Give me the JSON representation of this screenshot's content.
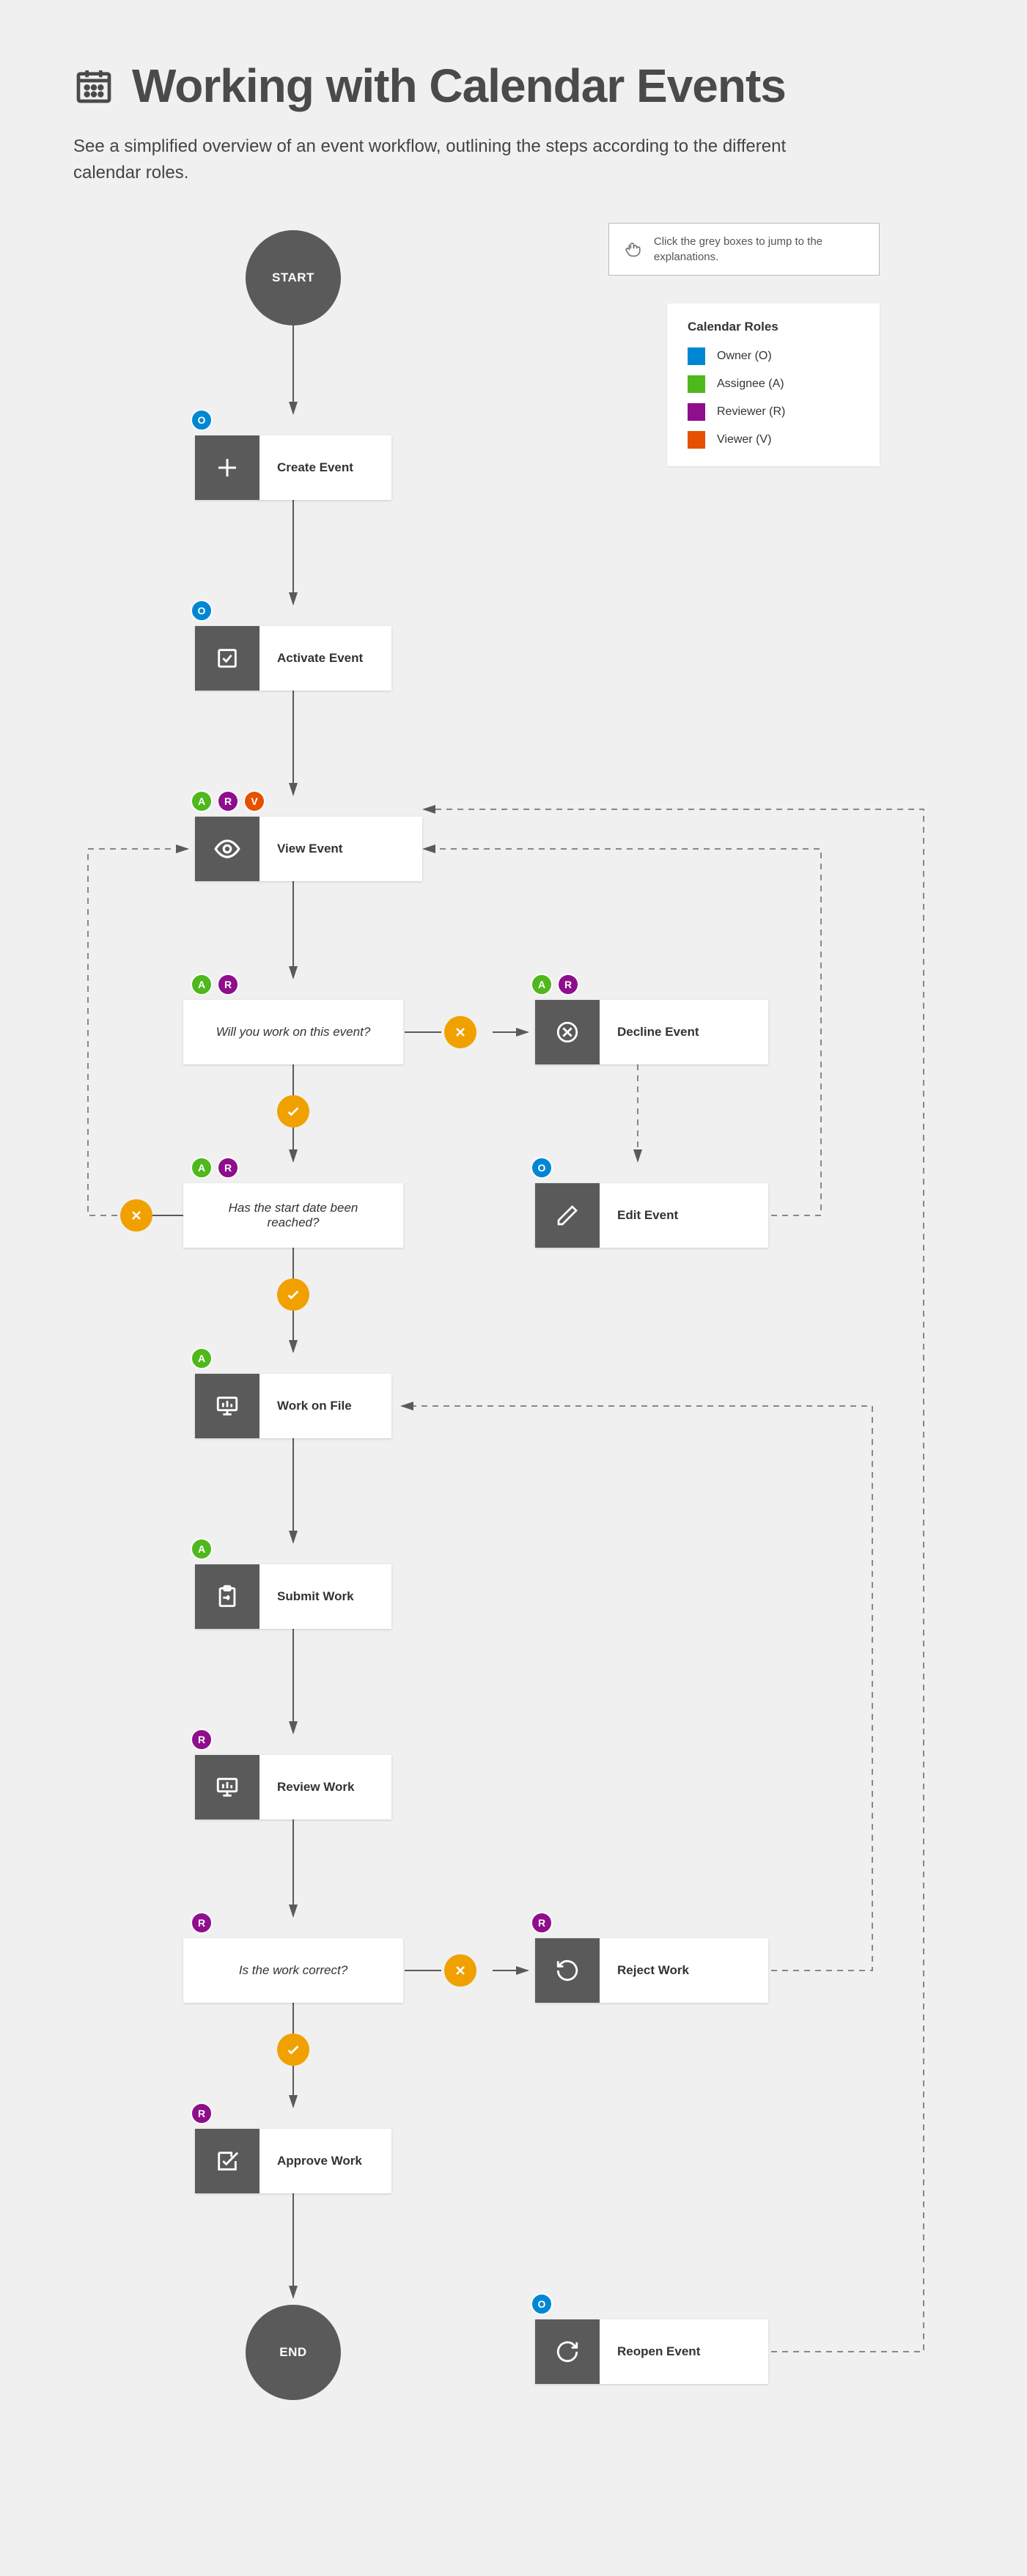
{
  "title": "Working with Calendar Events",
  "subtitle": "See a simplified overview of an event workflow, outlining the steps according to the different calendar roles.",
  "info_text": "Click the grey boxes to jump to the explanations.",
  "legend": {
    "title": "Calendar Roles",
    "items": [
      {
        "label": "Owner (O)",
        "color": "#0087d4"
      },
      {
        "label": "Assignee (A)",
        "color": "#4fb81c"
      },
      {
        "label": "Reviewer (R)",
        "color": "#8e0e8c"
      },
      {
        "label": "Viewer (V)",
        "color": "#e55100"
      }
    ]
  },
  "start": "START",
  "end": "END",
  "steps": {
    "create": "Create Event",
    "activate": "Activate Event",
    "view": "View Event",
    "decline": "Decline Event",
    "edit": "Edit Event",
    "work": "Work on File",
    "submit": "Submit Work",
    "review": "Review Work",
    "reject": "Reject Work",
    "approve": "Approve Work",
    "reopen": "Reopen Event"
  },
  "decisions": {
    "work_on": "Will you work on this event?",
    "date_reached": "Has the start date been reached?",
    "correct": "Is the work correct?"
  },
  "roles": {
    "create": [
      "O"
    ],
    "activate": [
      "O"
    ],
    "view": [
      "A",
      "R",
      "V"
    ],
    "work_on": [
      "A",
      "R"
    ],
    "decline": [
      "A",
      "R"
    ],
    "date_reached": [
      "A",
      "R"
    ],
    "edit": [
      "O"
    ],
    "work": [
      "A"
    ],
    "submit": [
      "A"
    ],
    "review": [
      "R"
    ],
    "correct": [
      "R"
    ],
    "reject": [
      "R"
    ],
    "approve": [
      "R"
    ],
    "reopen": [
      "O"
    ]
  },
  "chart_data": {
    "type": "flowchart",
    "nodes": [
      {
        "id": "start",
        "type": "terminal",
        "label": "START"
      },
      {
        "id": "create",
        "type": "process",
        "label": "Create Event",
        "roles": [
          "O"
        ]
      },
      {
        "id": "activate",
        "type": "process",
        "label": "Activate Event",
        "roles": [
          "O"
        ]
      },
      {
        "id": "view",
        "type": "process",
        "label": "View Event",
        "roles": [
          "A",
          "R",
          "V"
        ]
      },
      {
        "id": "work_on",
        "type": "decision",
        "label": "Will you work on this event?",
        "roles": [
          "A",
          "R"
        ]
      },
      {
        "id": "decline",
        "type": "process",
        "label": "Decline Event",
        "roles": [
          "A",
          "R"
        ]
      },
      {
        "id": "edit",
        "type": "process",
        "label": "Edit Event",
        "roles": [
          "O"
        ]
      },
      {
        "id": "date_reached",
        "type": "decision",
        "label": "Has the start date been reached?",
        "roles": [
          "A",
          "R"
        ]
      },
      {
        "id": "work",
        "type": "process",
        "label": "Work on File",
        "roles": [
          "A"
        ]
      },
      {
        "id": "submit",
        "type": "process",
        "label": "Submit Work",
        "roles": [
          "A"
        ]
      },
      {
        "id": "review",
        "type": "process",
        "label": "Review Work",
        "roles": [
          "R"
        ]
      },
      {
        "id": "correct",
        "type": "decision",
        "label": "Is the work correct?",
        "roles": [
          "R"
        ]
      },
      {
        "id": "reject",
        "type": "process",
        "label": "Reject Work",
        "roles": [
          "R"
        ]
      },
      {
        "id": "approve",
        "type": "process",
        "label": "Approve Work",
        "roles": [
          "R"
        ]
      },
      {
        "id": "end",
        "type": "terminal",
        "label": "END"
      },
      {
        "id": "reopen",
        "type": "process",
        "label": "Reopen Event",
        "roles": [
          "O"
        ]
      }
    ],
    "edges": [
      {
        "from": "start",
        "to": "create"
      },
      {
        "from": "create",
        "to": "activate"
      },
      {
        "from": "activate",
        "to": "view"
      },
      {
        "from": "view",
        "to": "work_on"
      },
      {
        "from": "work_on",
        "to": "date_reached",
        "label": "yes"
      },
      {
        "from": "work_on",
        "to": "decline",
        "label": "no"
      },
      {
        "from": "decline",
        "to": "edit"
      },
      {
        "from": "edit",
        "to": "view"
      },
      {
        "from": "date_reached",
        "to": "work",
        "label": "yes"
      },
      {
        "from": "date_reached",
        "to": "view",
        "label": "no"
      },
      {
        "from": "work",
        "to": "submit"
      },
      {
        "from": "submit",
        "to": "review"
      },
      {
        "from": "review",
        "to": "correct"
      },
      {
        "from": "correct",
        "to": "approve",
        "label": "yes"
      },
      {
        "from": "correct",
        "to": "reject",
        "label": "no"
      },
      {
        "from": "reject",
        "to": "work"
      },
      {
        "from": "approve",
        "to": "end"
      },
      {
        "from": "reopen",
        "to": "view"
      },
      {
        "from": "end",
        "to": "reopen",
        "relation": "adjacent"
      }
    ]
  }
}
